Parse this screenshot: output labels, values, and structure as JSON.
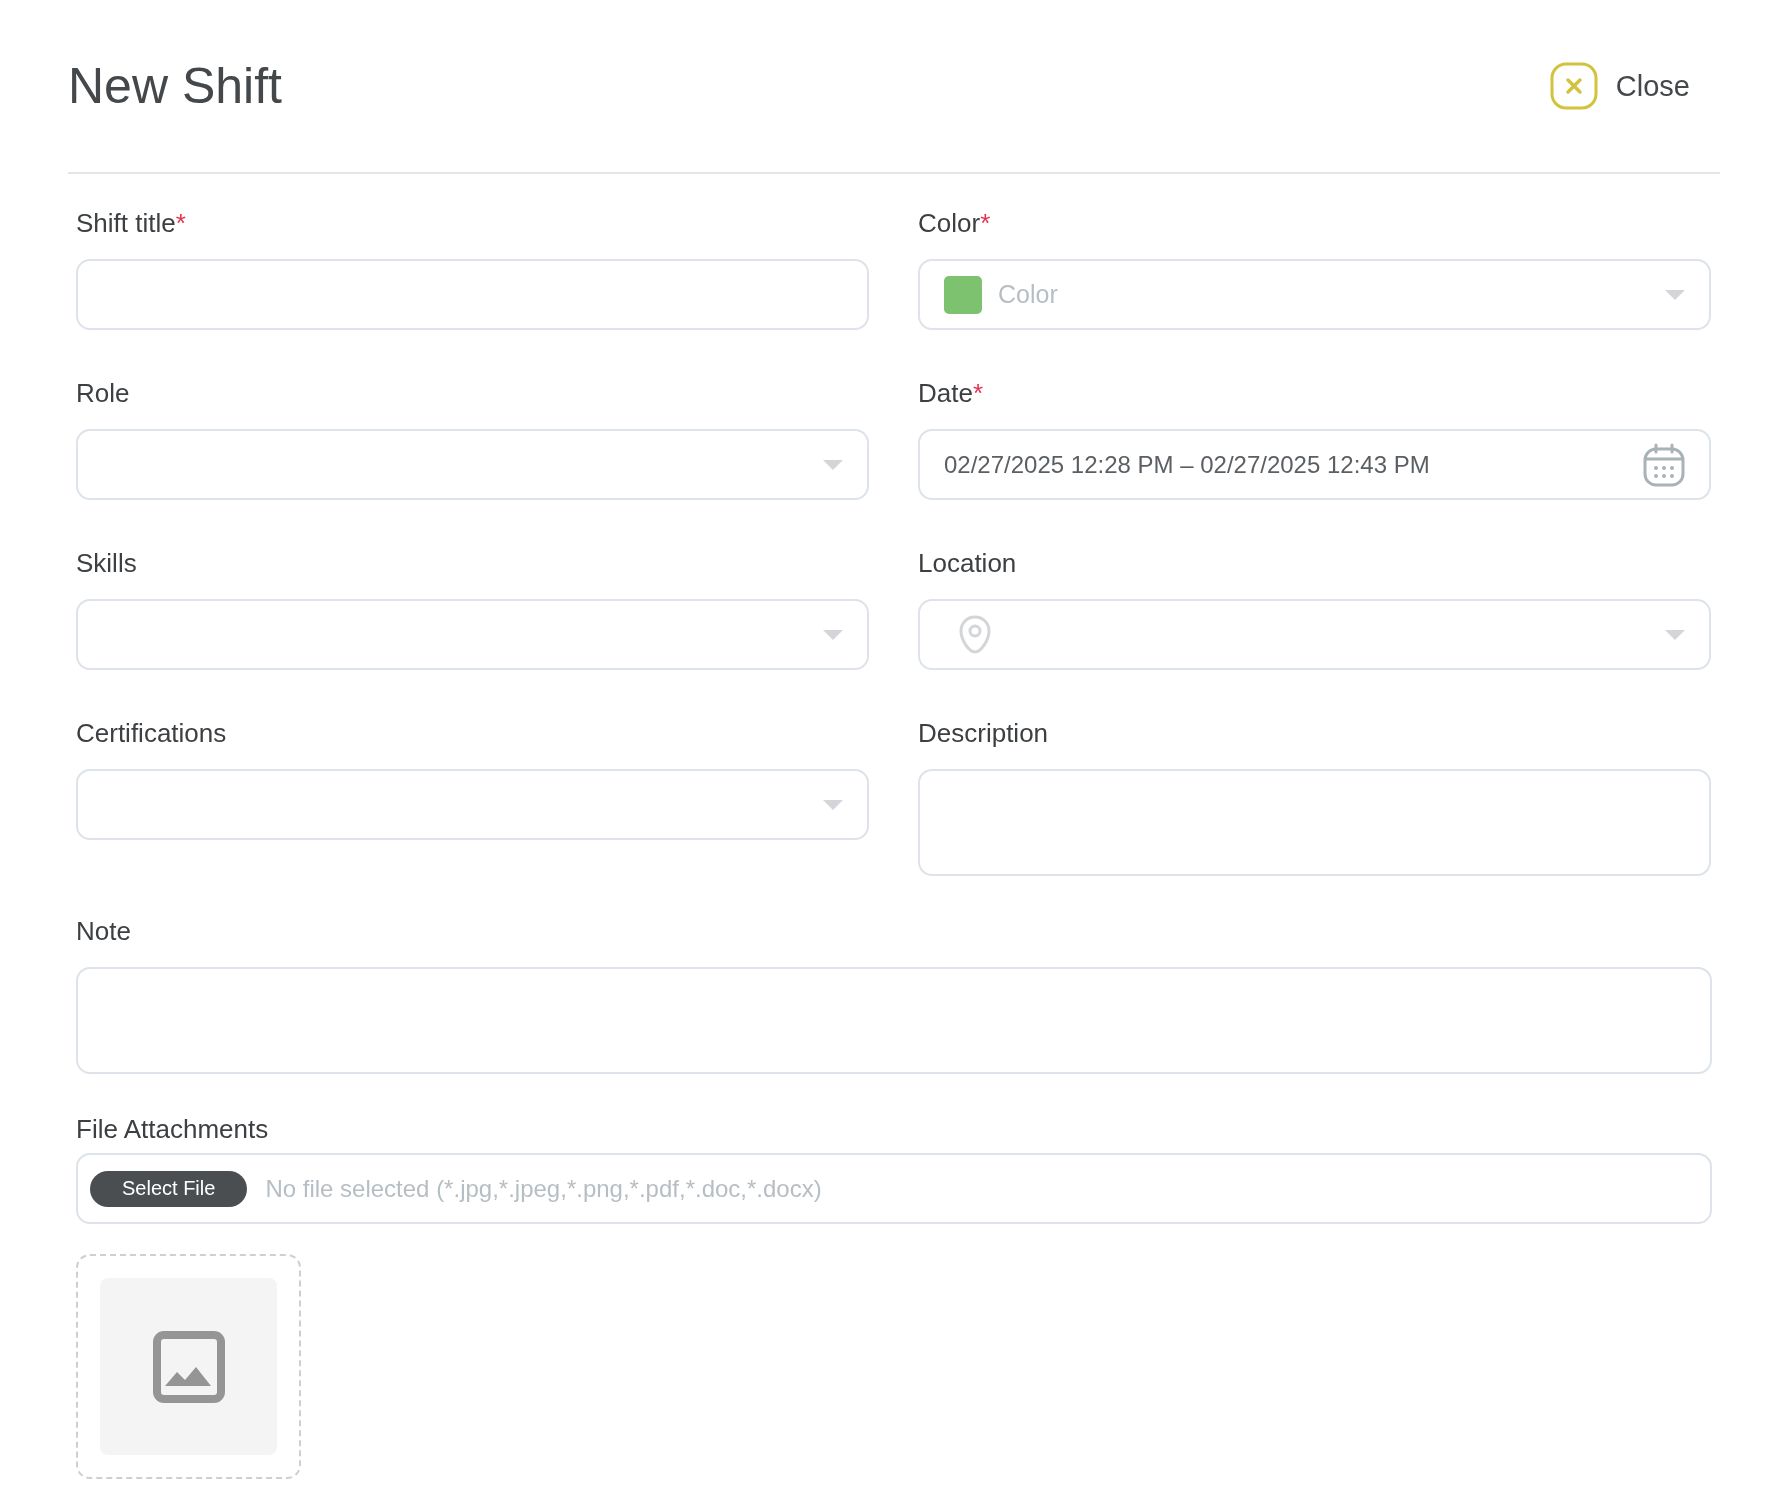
{
  "header": {
    "title": "New Shift",
    "close_button": "Close"
  },
  "fields": [
    {
      "kind": "text",
      "label": "Shift title",
      "required_mark": "*"
    },
    {
      "kind": "color",
      "label": "Color",
      "required_mark": "*",
      "placeholder": "Color",
      "color": "#7dc36f"
    },
    {
      "kind": "select",
      "label": "Role"
    },
    {
      "kind": "date",
      "label": "Date",
      "required_mark": "*",
      "value": "02/27/2025 12:28 PM – 02/27/2025 12:43 PM"
    },
    {
      "kind": "select",
      "label": "Skills"
    },
    {
      "kind": "location",
      "label": "Location"
    },
    {
      "kind": "select",
      "label": "Certifications"
    },
    {
      "kind": "textarea",
      "label": "Description"
    }
  ],
  "note": {
    "label": "Note"
  },
  "attachments": {
    "label": "File Attachments",
    "button": "Select File",
    "status_text": "No file selected (*.jpg,*.jpeg,*.png,*.pdf,*.doc,*.docx)"
  }
}
